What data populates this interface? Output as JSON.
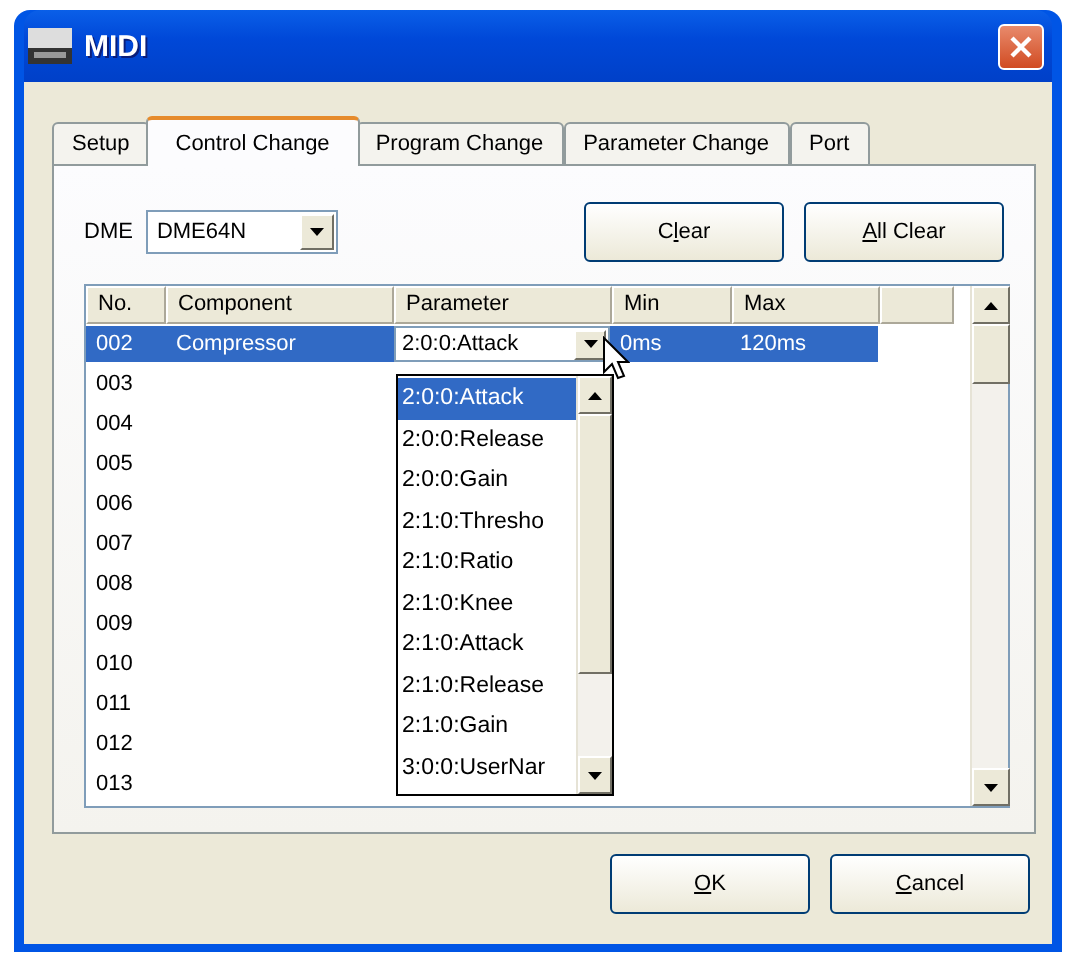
{
  "window": {
    "title": "MIDI"
  },
  "tabs": [
    {
      "label": "Setup",
      "selected": false
    },
    {
      "label": "Control Change",
      "selected": true
    },
    {
      "label": "Program Change",
      "selected": false
    },
    {
      "label": "Parameter Change",
      "selected": false
    },
    {
      "label": "Port",
      "selected": false
    }
  ],
  "device": {
    "label": "DME",
    "value": "DME64N"
  },
  "top_buttons": [
    {
      "before": "C",
      "key": "l",
      "after": "ear"
    },
    {
      "key": "A",
      "after": "ll Clear"
    }
  ],
  "table": {
    "columns": [
      "No.",
      "Component",
      "Parameter",
      "Min",
      "Max"
    ],
    "rows": [
      {
        "no": "002",
        "component": "Compressor",
        "parameter": "2:0:0:Attack",
        "min": "0ms",
        "max": "120ms",
        "selected": true
      },
      {
        "no": "003",
        "selected": false
      },
      {
        "no": "004",
        "selected": false
      },
      {
        "no": "005",
        "selected": false
      },
      {
        "no": "006",
        "selected": false
      },
      {
        "no": "007",
        "selected": false
      },
      {
        "no": "008",
        "selected": false
      },
      {
        "no": "009",
        "selected": false
      },
      {
        "no": "010",
        "selected": false
      },
      {
        "no": "011",
        "selected": false
      },
      {
        "no": "012",
        "selected": false
      },
      {
        "no": "013",
        "selected": false
      }
    ]
  },
  "parameter_dropdown": [
    {
      "label": "2:0:0:Attack",
      "selected": true
    },
    {
      "label": "2:0:0:Release",
      "selected": false
    },
    {
      "label": "2:0:0:Gain",
      "selected": false
    },
    {
      "label": "2:1:0:Thresho",
      "selected": false
    },
    {
      "label": "2:1:0:Ratio",
      "selected": false
    },
    {
      "label": "2:1:0:Knee",
      "selected": false
    },
    {
      "label": "2:1:0:Attack",
      "selected": false
    },
    {
      "label": "2:1:0:Release",
      "selected": false
    },
    {
      "label": "2:1:0:Gain",
      "selected": false
    },
    {
      "label": "3:0:0:UserNar",
      "selected": false
    }
  ],
  "bottom_buttons": [
    {
      "key": "O",
      "after": "K"
    },
    {
      "key": "C",
      "after": "ancel"
    }
  ]
}
